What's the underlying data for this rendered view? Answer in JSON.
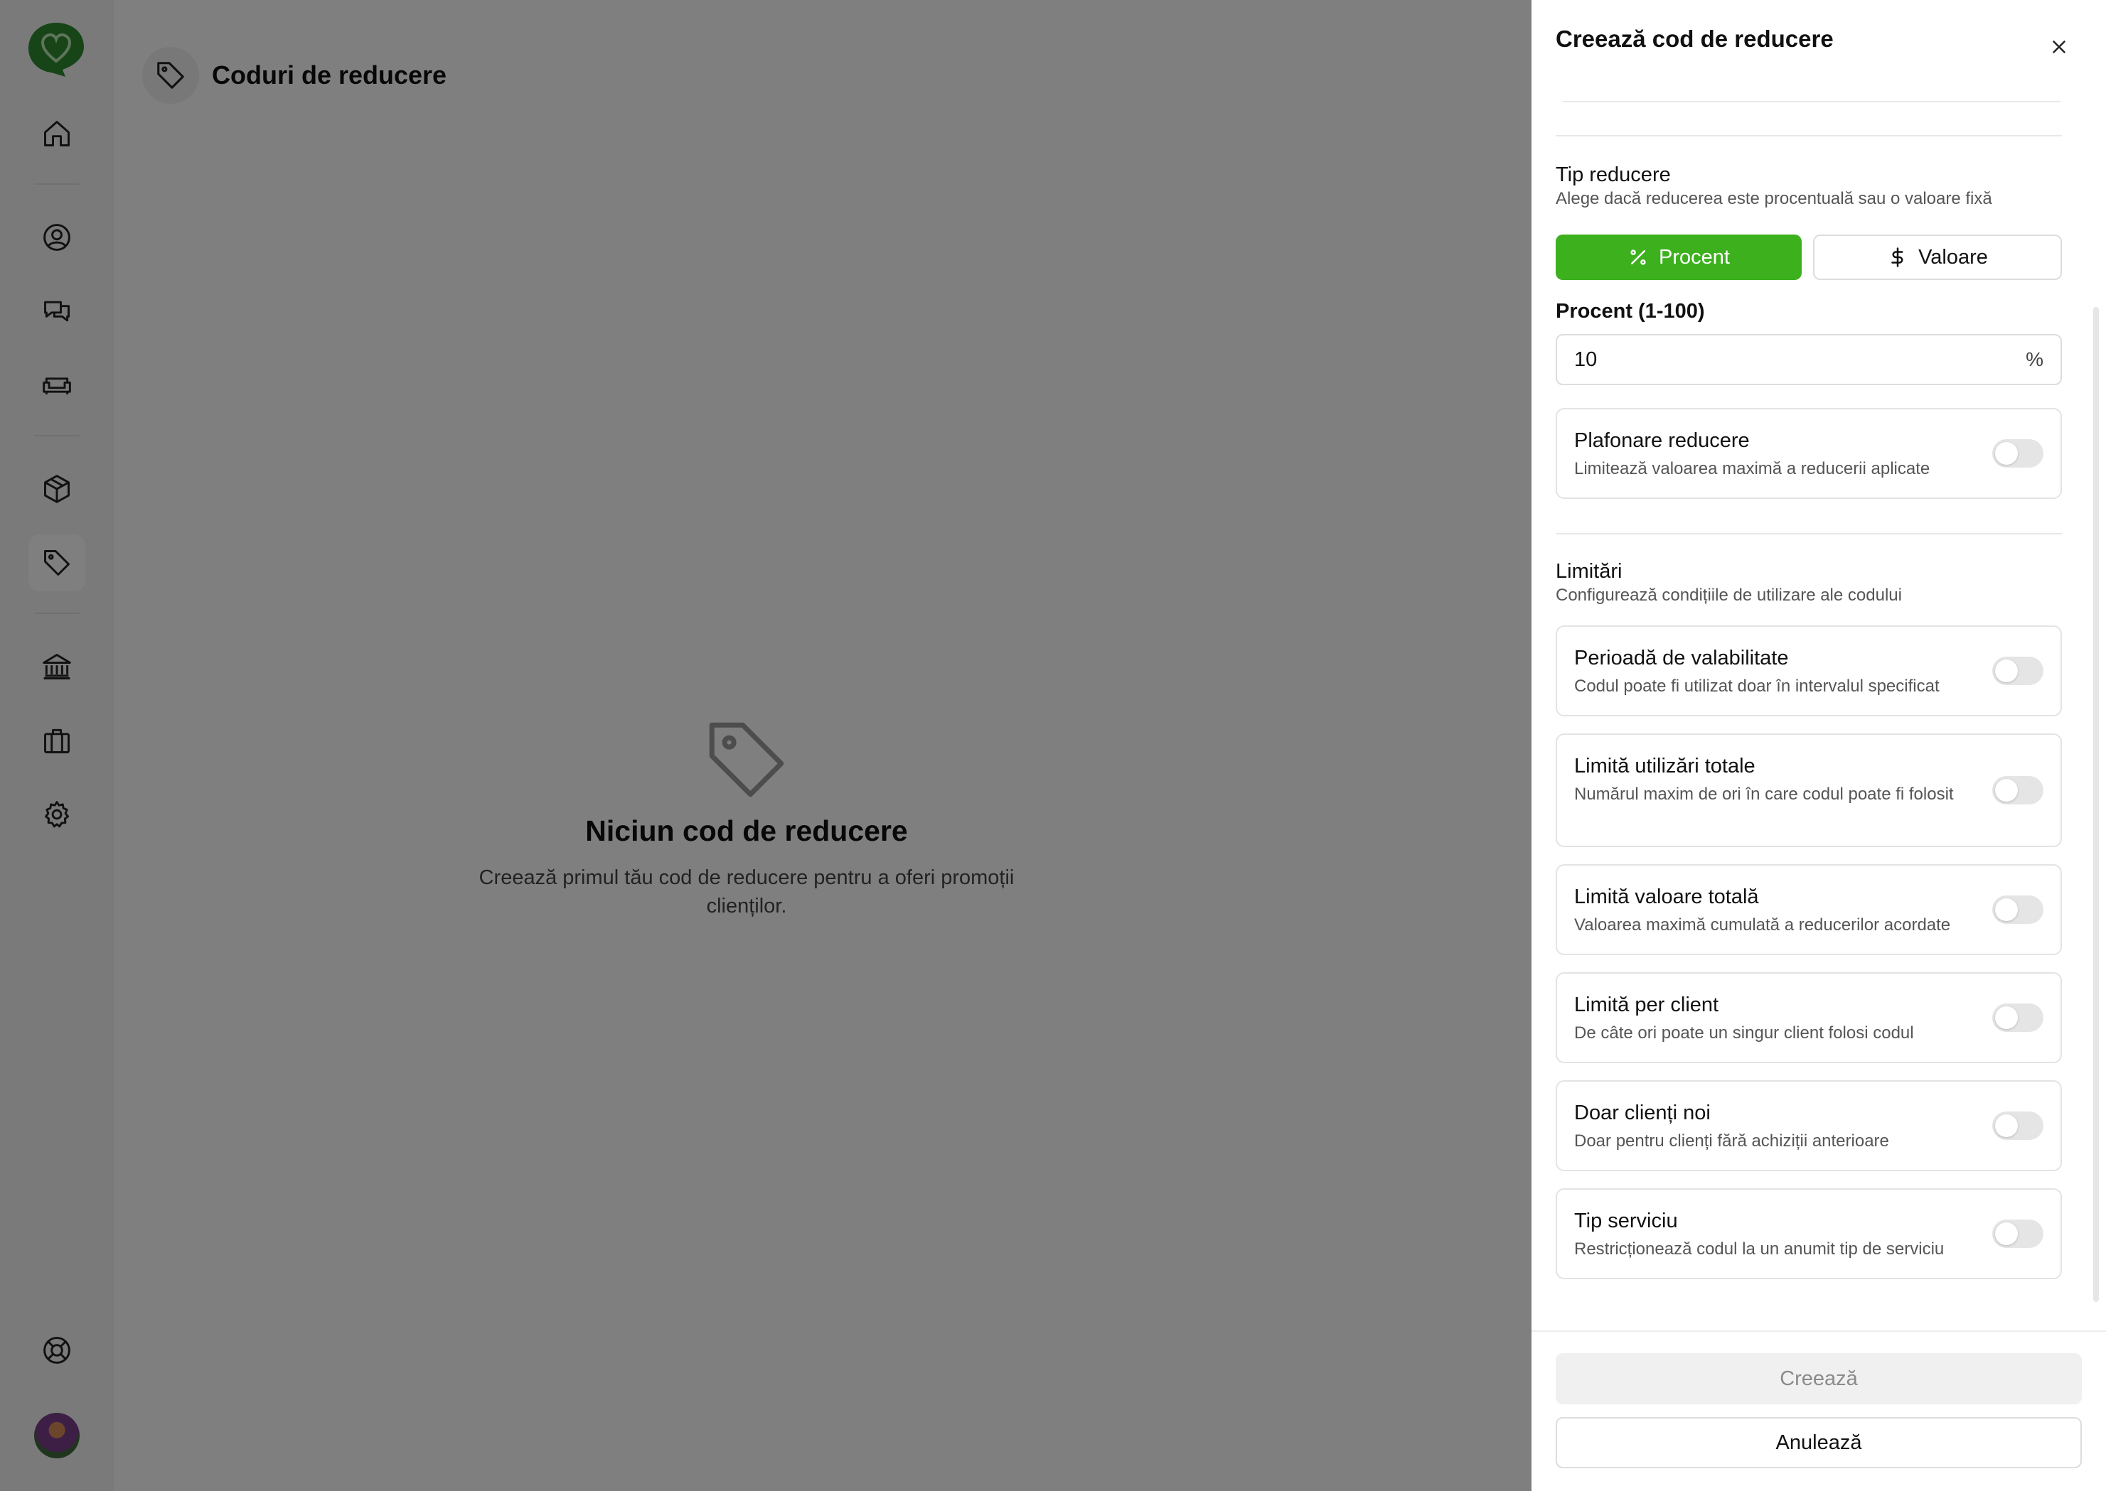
{
  "page": {
    "title": "Coduri de reducere",
    "empty_title": "Niciun cod de reducere",
    "empty_text": "Creează primul tău cod de reducere pentru a oferi promoții clienților."
  },
  "sidebar": {
    "items": [
      {
        "icon": "home-icon"
      },
      {
        "icon": "user-circle-icon"
      },
      {
        "icon": "chat-icon"
      },
      {
        "icon": "sofa-icon"
      },
      {
        "icon": "box-icon"
      },
      {
        "icon": "tag-icon",
        "active": true
      },
      {
        "icon": "bank-icon"
      },
      {
        "icon": "briefcase-icon"
      },
      {
        "icon": "gear-icon"
      },
      {
        "icon": "lifebuoy-icon"
      }
    ]
  },
  "drawer": {
    "title": "Creează cod de reducere",
    "discount_type": {
      "title": "Tip reducere",
      "subtitle": "Alege dacă reducerea este procentuală sau o valoare fixă",
      "options": [
        "Procent",
        "Valoare"
      ],
      "selected": "Procent"
    },
    "percent_field": {
      "label": "Procent (1-100)",
      "value": "10",
      "suffix": "%"
    },
    "cap": {
      "title": "Plafonare reducere",
      "description": "Limitează valoarea maximă a reducerii aplicate",
      "enabled": false
    },
    "limits": {
      "title": "Limitări",
      "subtitle": "Configurează condițiile de utilizare ale codului",
      "items": [
        {
          "title": "Perioadă de valabilitate",
          "description": "Codul poate fi utilizat doar în intervalul specificat",
          "enabled": false
        },
        {
          "title": "Limită utilizări totale",
          "description": "Numărul maxim de ori în care codul poate fi folosit",
          "enabled": false
        },
        {
          "title": "Limită valoare totală",
          "description": "Valoarea maximă cumulată a reducerilor acordate",
          "enabled": false
        },
        {
          "title": "Limită per client",
          "description": "De câte ori poate un singur client folosi codul",
          "enabled": false
        },
        {
          "title": "Doar clienți noi",
          "description": "Doar pentru clienți fără achiziții anterioare",
          "enabled": false
        },
        {
          "title": "Tip serviciu",
          "description": "Restricționează codul la un anumit tip de serviciu",
          "enabled": false
        }
      ]
    },
    "buttons": {
      "create": "Creează",
      "cancel": "Anulează"
    }
  },
  "colors": {
    "accent": "#3db01e",
    "brand_logo": "#2e8b2e",
    "overlay": "rgba(0,0,0,0.5)"
  }
}
